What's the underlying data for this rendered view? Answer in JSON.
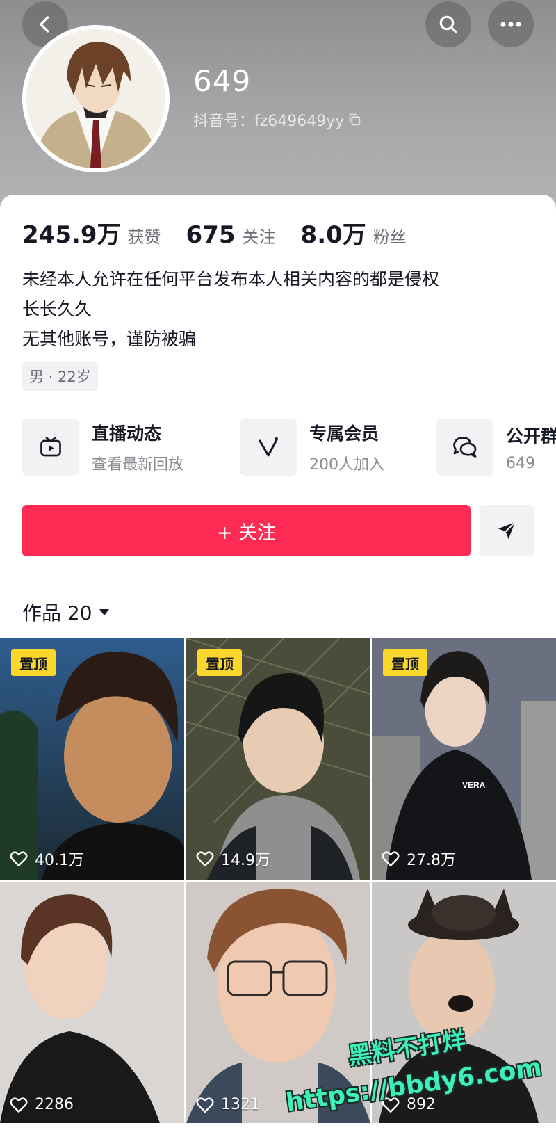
{
  "profile": {
    "nickname": "649",
    "douyin_id": "抖音号：fz649649yy"
  },
  "stats": [
    {
      "value": "245.9万",
      "label": "获赞"
    },
    {
      "value": "675",
      "label": "关注"
    },
    {
      "value": "8.0万",
      "label": "粉丝"
    }
  ],
  "bio": {
    "lines": [
      "未经本人允许在任何平台发布本人相关内容的都是侵权",
      "长长久久",
      "无其他账号，谨防被骗"
    ],
    "tag": "男 · 22岁"
  },
  "features": [
    {
      "title": "直播动态",
      "subtitle": "查看最新回放",
      "icon": "tv-icon"
    },
    {
      "title": "专属会员",
      "subtitle": "200人加入",
      "icon": "v-icon"
    },
    {
      "title": "公开群",
      "subtitle": "649",
      "icon": "chat-icon"
    }
  ],
  "actions": {
    "follow_label": "+ 关注"
  },
  "works": {
    "label": "作品 20"
  },
  "videos": [
    {
      "pinned": "置顶",
      "likes": "40.1万"
    },
    {
      "pinned": "置顶",
      "likes": "14.9万"
    },
    {
      "pinned": "置顶",
      "likes": "27.8万"
    },
    {
      "pinned": "",
      "likes": "2286"
    },
    {
      "pinned": "",
      "likes": "1321"
    },
    {
      "pinned": "",
      "likes": "892"
    }
  ],
  "watermark": {
    "line1": "黑料不打烊",
    "line2": "https://bbdy6.com"
  },
  "colors": {
    "accent": "#fe2c55",
    "pinned": "#fbd72b",
    "watermark": "#3ef0b6"
  }
}
